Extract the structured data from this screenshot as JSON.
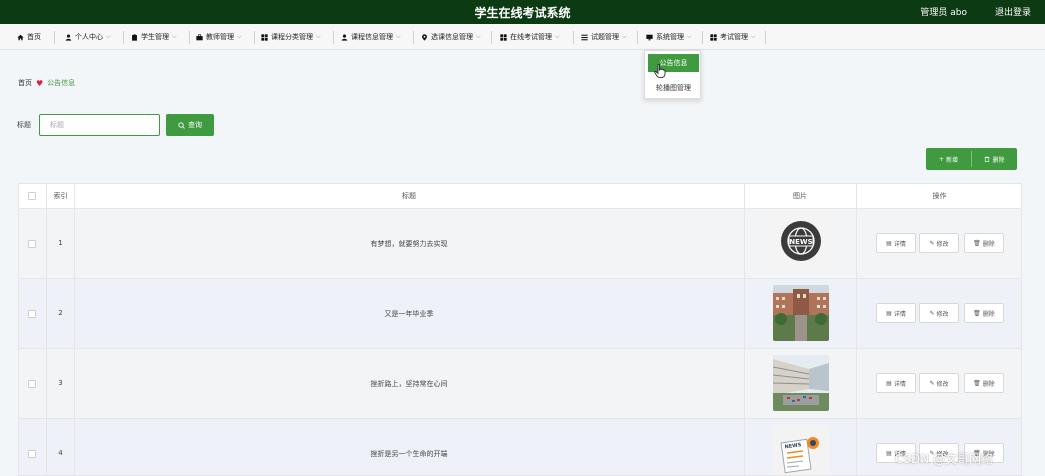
{
  "header": {
    "title": "学生在线考试系统",
    "user_label": "管理员 abo",
    "logout_label": "退出登录"
  },
  "nav": {
    "items": [
      {
        "label": "首页",
        "icon": "home-icon",
        "dropdown": false
      },
      {
        "label": "个人中心",
        "icon": "person-icon",
        "dropdown": true
      },
      {
        "label": "学生管理",
        "icon": "clipboard-icon",
        "dropdown": true
      },
      {
        "label": "教师管理",
        "icon": "briefcase-icon",
        "dropdown": true
      },
      {
        "label": "课程分类管理",
        "icon": "grid-icon",
        "dropdown": true
      },
      {
        "label": "课程信息管理",
        "icon": "person-icon",
        "dropdown": true
      },
      {
        "label": "选课信息管理",
        "icon": "pin-icon",
        "dropdown": true
      },
      {
        "label": "在线考试管理",
        "icon": "grid-icon",
        "dropdown": true
      },
      {
        "label": "试题管理",
        "icon": "list-icon",
        "dropdown": true
      },
      {
        "label": "系统管理",
        "icon": "monitor-icon",
        "dropdown": true
      },
      {
        "label": "考试管理",
        "icon": "grid-icon",
        "dropdown": true
      }
    ]
  },
  "dropdown": {
    "items": [
      "公告信息",
      "轮播图管理"
    ]
  },
  "breadcrumb": {
    "home": "首页",
    "current": "公告信息"
  },
  "search": {
    "label": "标题",
    "placeholder": "标题",
    "button_label": "查询"
  },
  "actions": {
    "add_label": "新增",
    "delete_label": "删除"
  },
  "table": {
    "columns": [
      "索引",
      "标题",
      "图片",
      "操作"
    ],
    "rows": [
      {
        "index": "1",
        "title": "有梦想，就要努力去实现",
        "image": "news-globe-image"
      },
      {
        "index": "2",
        "title": "又是一年毕业季",
        "image": "campus-building-image"
      },
      {
        "index": "3",
        "title": "挫折路上，坚持常在心间",
        "image": "campus-courtyard-image"
      },
      {
        "index": "4",
        "title": "挫折是另一个生命的开端",
        "image": "news-paper-image"
      }
    ],
    "op_labels": {
      "detail": "详情",
      "edit": "修改",
      "delete": "删除"
    }
  },
  "watermark": "CSDN @文哥网络",
  "colors": {
    "header_bg": "#0c3a12",
    "accent": "#3f9a40",
    "heart": "#e0203b"
  }
}
